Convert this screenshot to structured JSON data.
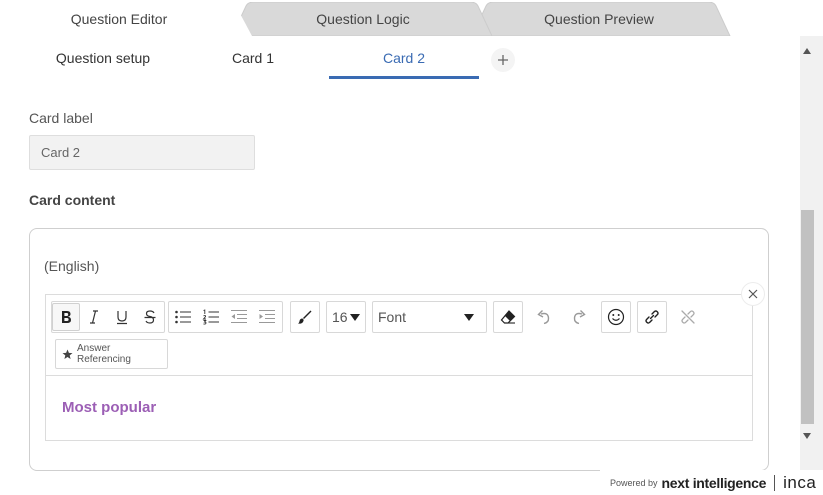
{
  "top_tabs": [
    {
      "label": "Question Editor",
      "active": true
    },
    {
      "label": "Question Logic",
      "active": false
    },
    {
      "label": "Question Preview",
      "active": false
    }
  ],
  "sub_tabs": [
    {
      "label": "Question setup",
      "active": false
    },
    {
      "label": "Card 1",
      "active": false
    },
    {
      "label": "Card 2",
      "active": true
    }
  ],
  "card_label": {
    "label": "Card label",
    "value": "Card 2"
  },
  "card_content": {
    "label": "Card content",
    "language": "(English)"
  },
  "toolbar": {
    "font_size": "16",
    "font": "Font",
    "answer_referencing": "Answer Referencing"
  },
  "editor": {
    "text": "Most popular"
  },
  "footer": {
    "powered_by": "Powered by",
    "brand": "next intelligence",
    "brand2": "inca"
  },
  "colors": {
    "accent": "#3a6bb3",
    "editor_text": "#9c5fb5"
  }
}
